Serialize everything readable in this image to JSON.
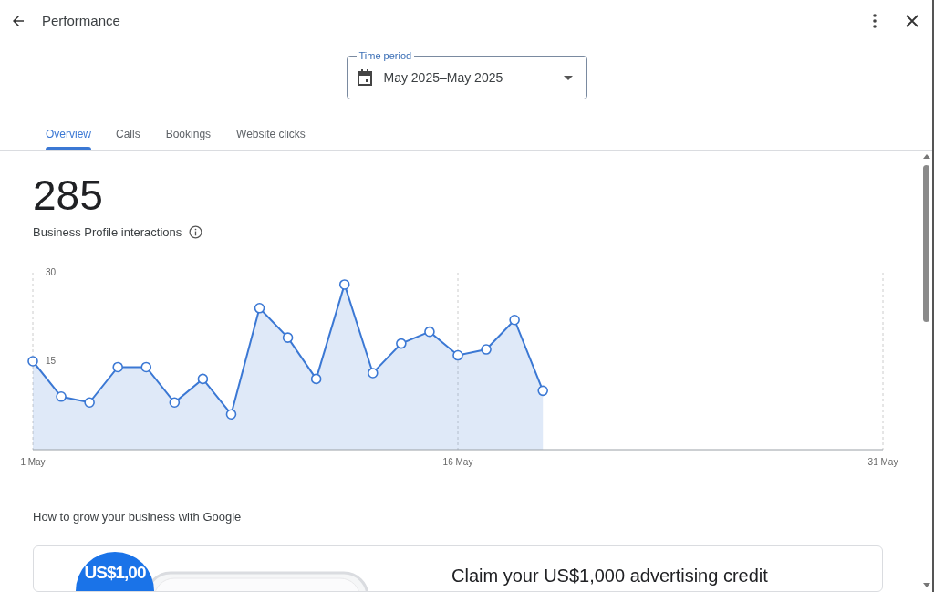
{
  "header": {
    "title": "Performance"
  },
  "time_period": {
    "label": "Time period",
    "value": "May 2025–May 2025"
  },
  "tabs": [
    {
      "label": "Overview",
      "selected": true
    },
    {
      "label": "Calls",
      "selected": false
    },
    {
      "label": "Bookings",
      "selected": false
    },
    {
      "label": "Website clicks",
      "selected": false
    }
  ],
  "summary": {
    "total": "285",
    "label": "Business Profile interactions"
  },
  "chart_data": {
    "type": "area",
    "categories": [
      "1 May",
      null,
      null,
      null,
      null,
      null,
      null,
      null,
      null,
      null,
      null,
      null,
      null,
      null,
      null,
      "16 May",
      null,
      null,
      null,
      null,
      null,
      null,
      null,
      null,
      null,
      null,
      null,
      null,
      null,
      null,
      "31 May"
    ],
    "series": [
      {
        "color": "#3b78d4",
        "values": [
          15,
          9,
          8,
          14,
          14,
          8,
          12,
          6,
          24,
          19,
          12,
          28,
          13,
          18,
          20,
          16,
          17,
          22,
          10,
          null,
          null,
          null,
          null,
          null,
          null,
          null,
          null,
          null,
          null,
          null,
          null
        ]
      }
    ],
    "ylim": [
      0,
      30
    ],
    "yticks": [
      15,
      30
    ]
  },
  "grow_section": {
    "title": "How to grow your business with Google",
    "card": {
      "badge": "US$1,00",
      "title": "Claim your US$1,000 advertising credit"
    }
  }
}
